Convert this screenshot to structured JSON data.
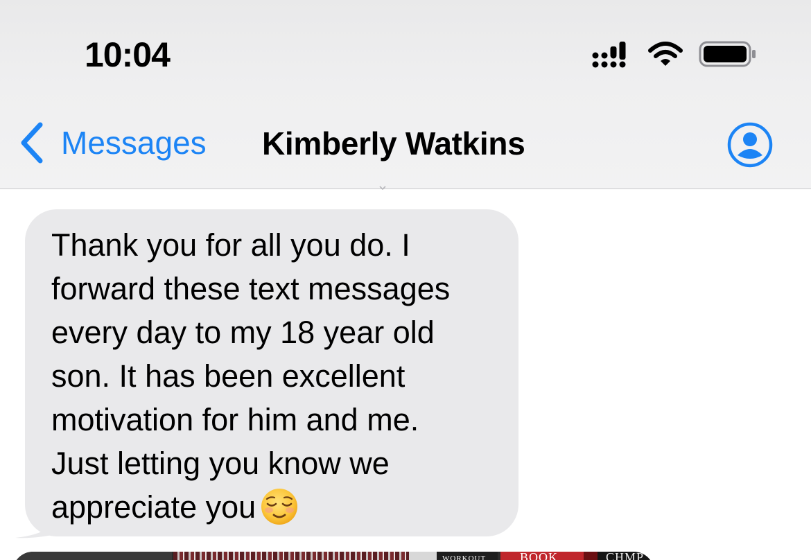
{
  "status_bar": {
    "time": "10:04",
    "icons": [
      "cellular-signal-icon",
      "wifi-icon",
      "battery-icon"
    ]
  },
  "nav": {
    "back_label": "Messages",
    "title": "Kimberly Watkins",
    "contact_icon": "person-circle-icon"
  },
  "messages": [
    {
      "direction": "incoming",
      "text": "Thank you for all you do.  I\nforward these text messages\nevery day to my 18 year old\nson.  It has been excellent\nmotivation for him and me.\nJust letting you know we\nappreciate you",
      "emoji": "relieved-face-emoji"
    }
  ],
  "image_preview": {
    "labels": [
      "WORKOUT",
      "BOOK",
      "CHMP"
    ]
  },
  "colors": {
    "accent": "#1c84f5",
    "bubble_incoming": "#e9e9eb",
    "header_bg": "#efeff0"
  }
}
